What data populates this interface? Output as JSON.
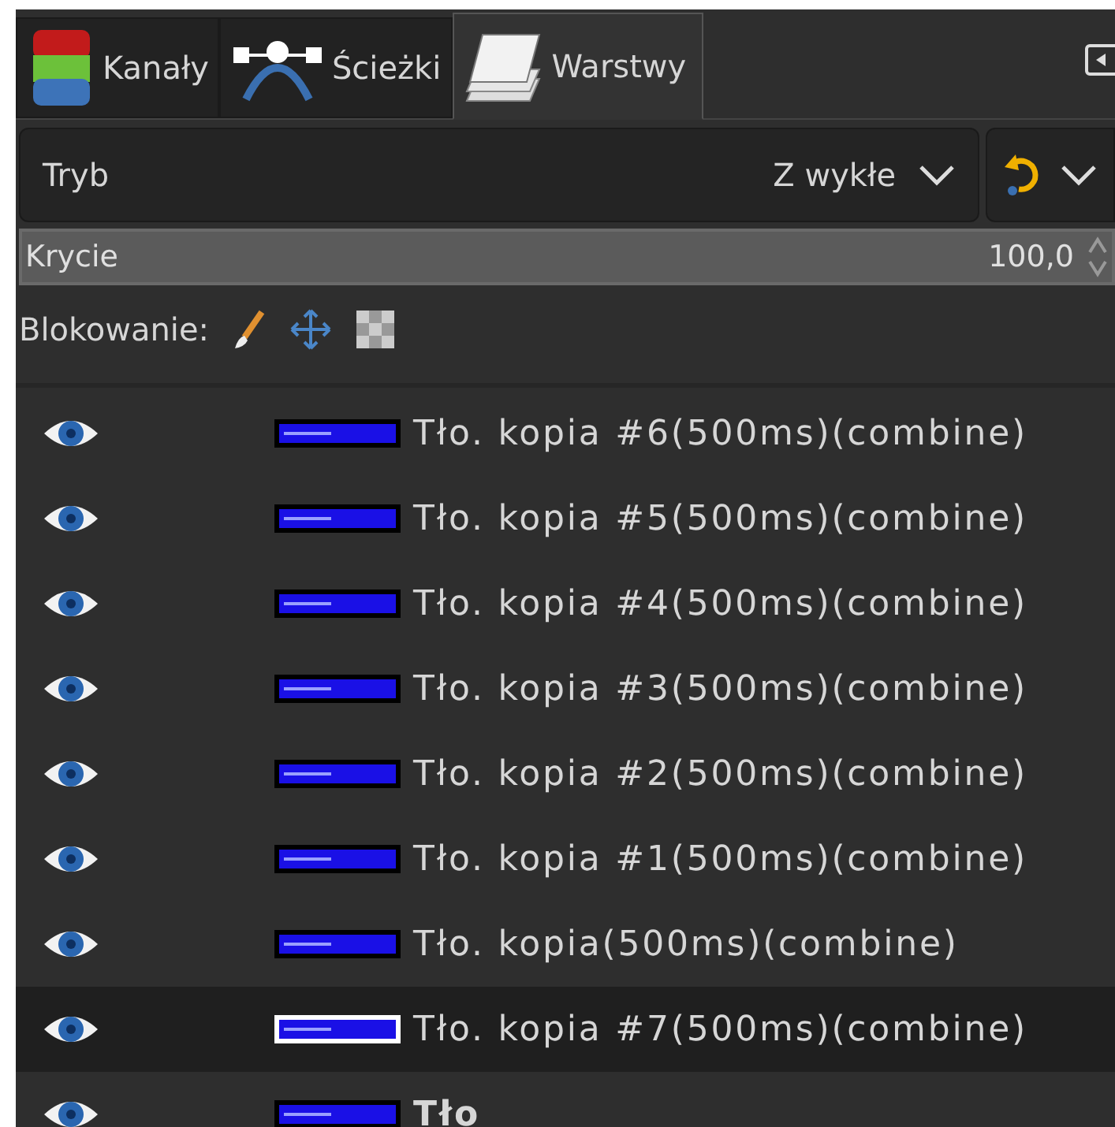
{
  "tabs": [
    {
      "label": "Kanały",
      "selected": false
    },
    {
      "label": "Ścieżki",
      "selected": false
    },
    {
      "label": "Warstwy",
      "selected": true
    }
  ],
  "mode": {
    "label": "Tryb",
    "value": "Z wykłe"
  },
  "opacity": {
    "label": "Krycie",
    "value": "100,0",
    "level": 1
  },
  "lock": {
    "label": "Blokowanie:"
  },
  "layers": [
    {
      "name": "Tło. kopia #6(500ms)(combine)",
      "visible": true,
      "selected": false,
      "has_alpha": true
    },
    {
      "name": "Tło. kopia #5(500ms)(combine)",
      "visible": true,
      "selected": false,
      "has_alpha": true
    },
    {
      "name": "Tło. kopia #4(500ms)(combine)",
      "visible": true,
      "selected": false,
      "has_alpha": true
    },
    {
      "name": "Tło. kopia #3(500ms)(combine)",
      "visible": true,
      "selected": false,
      "has_alpha": true
    },
    {
      "name": "Tło. kopia #2(500ms)(combine)",
      "visible": true,
      "selected": false,
      "has_alpha": true
    },
    {
      "name": "Tło. kopia #1(500ms)(combine)",
      "visible": true,
      "selected": false,
      "has_alpha": true
    },
    {
      "name": "Tło. kopia(500ms)(combine)",
      "visible": true,
      "selected": false,
      "has_alpha": true
    },
    {
      "name": "Tło. kopia #7(500ms)(combine)",
      "visible": true,
      "selected": true,
      "has_alpha": true
    },
    {
      "name": "Tło",
      "visible": true,
      "selected": false,
      "has_alpha": false
    }
  ]
}
